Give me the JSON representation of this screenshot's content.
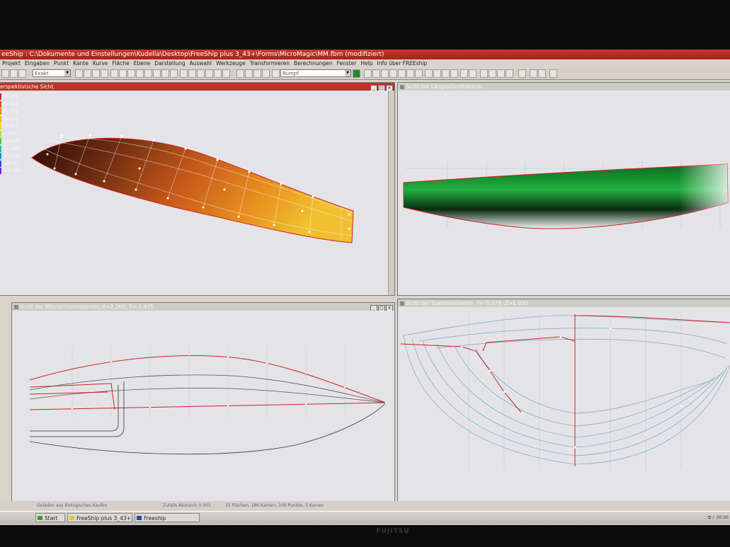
{
  "window": {
    "title": "eeShip  : C:\\Dokumente und Einstellungen\\Kudella\\Desktop\\FreeShip plus 3_43+\\Forms\\MicroMagic\\MM.fbm (modifiziert)"
  },
  "menu": [
    "Projekt",
    "Eingaben",
    "Punkt",
    "Kante",
    "Kurve",
    "Fläche",
    "Ebene",
    "Darstellung",
    "Auswahl",
    "Werkzeuge",
    "Transformieren",
    "Berechnungen",
    "Fenster",
    "Help",
    "Info über FREEship"
  ],
  "toolbar": {
    "precision": "Exakt",
    "layer": "Rumpf"
  },
  "views": {
    "perspective": {
      "title": "erspektivische Sicht."
    },
    "profile": {
      "title": "Sicht der Längsschnittebene."
    },
    "plan": {
      "title": "Sicht der Wasserlinienebenen.  X=2.260,  Y=-1.435"
    },
    "body": {
      "title": "Sicht der Spantenebenen.  Y=-0.379,  Z=1.030"
    }
  },
  "legend": [
    {
      "label": "75.303",
      "color": "#d0202a"
    },
    {
      "label": "60.242",
      "color": "#e04a20"
    },
    {
      "label": "45.182",
      "color": "#e88420"
    },
    {
      "label": "30.121",
      "color": "#f0b820"
    },
    {
      "label": "15.061",
      "color": "#e8e020"
    },
    {
      "label": "0.000",
      "color": "#b8e030"
    },
    {
      "label": "-10.943",
      "color": "#40d040"
    },
    {
      "label": "-21.886",
      "color": "#20c0a0"
    },
    {
      "label": "-32.829",
      "color": "#2090d8"
    },
    {
      "label": "-43.771",
      "color": "#3050e0"
    },
    {
      "label": "-54.714",
      "color": "#6030d0"
    }
  ],
  "status": {
    "left": "Geladen aus Biologisches Kaufen",
    "mid": "Zufalls Abstand: 0.001",
    "right": "31 Flächen, 186 Kanten, 106 Punkte, 3 Kurven"
  },
  "taskbar": {
    "start": "Start",
    "items": [
      "FreeShip plus 3_43+",
      "Freeship"
    ],
    "clock": "00:00"
  },
  "monitor_brand": "FUJITSU",
  "colors": {
    "title_red": "#b82a1e",
    "hull_red": "#e03030",
    "hull_orange": "#e8801f",
    "hull_green": "#18a030"
  }
}
